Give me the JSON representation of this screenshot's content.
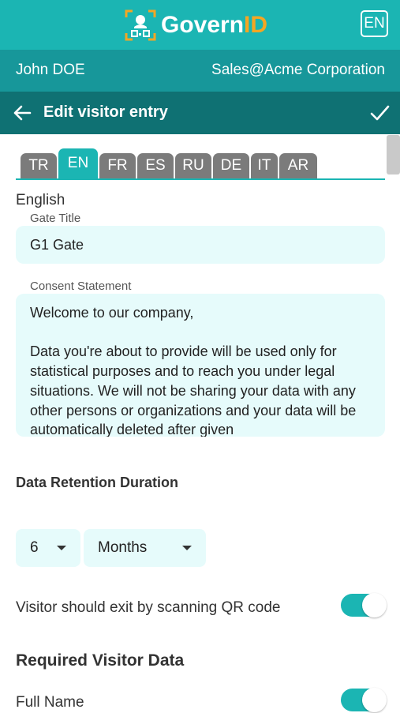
{
  "app": {
    "logo_main": "Govern",
    "logo_accent": "ID",
    "lang_button": "EN"
  },
  "user": {
    "name": "John DOE",
    "org": "Sales@Acme Corporation"
  },
  "toolbar": {
    "title": "Edit visitor entry"
  },
  "tabs": [
    {
      "label": "TR",
      "active": false
    },
    {
      "label": "EN",
      "active": true
    },
    {
      "label": "FR",
      "active": false
    },
    {
      "label": "ES",
      "active": false
    },
    {
      "label": "RU",
      "active": false
    },
    {
      "label": "DE",
      "active": false
    },
    {
      "label": "IT",
      "active": false
    },
    {
      "label": "AR",
      "active": false
    }
  ],
  "form": {
    "language": "English",
    "gate_label": "Gate Title",
    "gate_value": "G1 Gate",
    "consent_label": "Consent Statement",
    "consent_line1": "Welcome to our company,",
    "consent_line2": "Data you're about to provide will be used only for statistical purposes and to reach you under legal situations. We will not be sharing your data with any other persons or organizations and your data will be automatically deleted after given"
  },
  "retention": {
    "heading": "Data Retention Duration",
    "amount": "6",
    "unit": "Months"
  },
  "exit_qr": {
    "label": "Visitor should exit by scanning QR code",
    "enabled": true
  },
  "required": {
    "heading": "Required Visitor Data",
    "full_name_label": "Full Name",
    "full_name_enabled": true
  },
  "colors": {
    "primary": "#1bb5b3",
    "user_bar": "#17979a",
    "title_bar": "#0f7173",
    "accent": "#f5a623",
    "field_bg": "#e6fbfb",
    "tab_inactive": "#7b7b7b"
  }
}
